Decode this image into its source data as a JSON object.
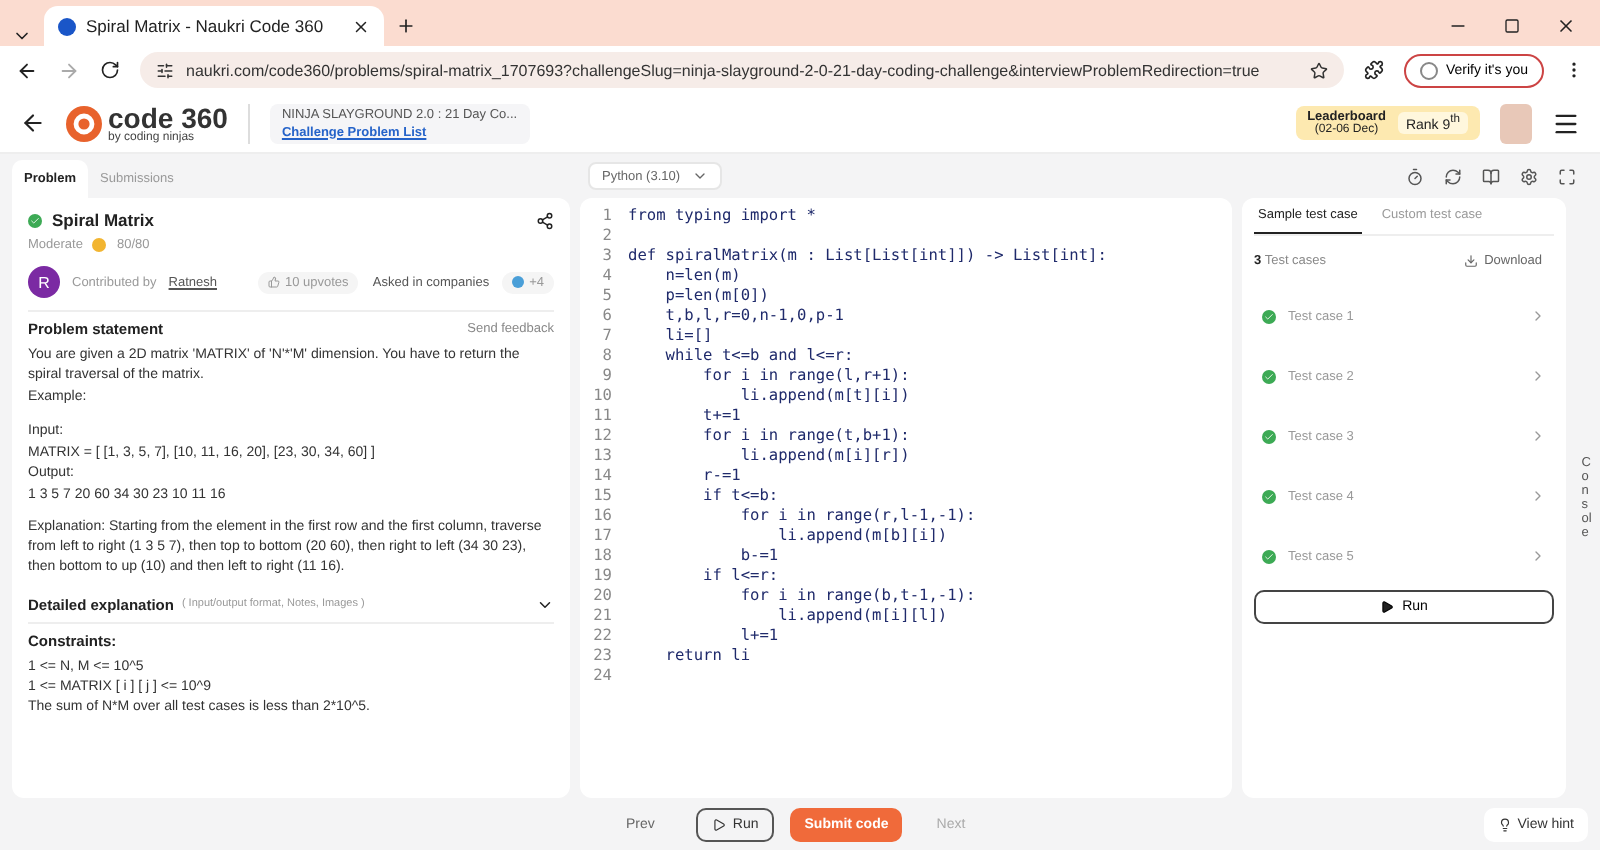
{
  "browser": {
    "tab_title": "Spiral Matrix - Naukri Code 360",
    "url": "naukri.com/code360/problems/spiral-matrix_1707693?challengeSlug=ninja-slayground-2-0-21-day-coding-challenge&interviewProblemRedirection=true",
    "verify": "Verify it's you"
  },
  "header": {
    "logo_main": "code 360",
    "logo_sub": "by coding ninjas",
    "challenge_title": "NINJA SLAYGROUND 2.0 : 21 Day Co...",
    "challenge_link": "Challenge Problem List",
    "leaderboard": "Leaderboard",
    "leaderboard_dates": "(02-06 Dec)",
    "rank": "Rank 9",
    "rank_sup": "th"
  },
  "problem_tabs": [
    {
      "label": "Problem",
      "selected": true
    },
    {
      "label": "Submissions",
      "selected": false
    }
  ],
  "problem": {
    "title": "Spiral Matrix",
    "solved": true,
    "difficulty": "Moderate",
    "score": "80/80",
    "avatar_letter": "R",
    "contributed_by": "Contributed by",
    "author": "Ratnesh",
    "upvotes": "10 upvotes",
    "asked_in": "Asked in companies",
    "companies_count": "+4",
    "statement_heading": "Problem statement",
    "feedback": "Send feedback",
    "paragraphs": [
      "You are given a 2D matrix 'MATRIX' of 'N'*'M' dimension. You have to return the spiral traversal of the matrix.",
      "Example:"
    ],
    "example_lines": [
      "Input:",
      "MATRIX = [ [1, 3, 5, 7], [10, 11, 16, 20], [23, 30, 34, 60] ]",
      "Output:",
      "1 3 5 7 20 60 34 30 23 10 11 16"
    ],
    "explanation": "Explanation: Starting from the element in the first row and the first column, traverse from left to right (1 3 5 7), then top to bottom (20 60), then right to left (34 30 23), then bottom to up (10) and then left to right (11 16).",
    "detailed_heading": "Detailed explanation",
    "detailed_hint": "( Input/output format, Notes, Images )",
    "detailed_expanded": false,
    "constraints_heading": "Constraints:",
    "constraints": [
      "1 <= N, M <= 10^5",
      "1 <= MATRIX [ i ] [ j ] <= 10^9",
      "The sum of N*M over all test cases is less than 2*10^5."
    ]
  },
  "editor": {
    "language": "Python (3.10)",
    "lines": [
      {
        "number": "1",
        "text": "from typing import *"
      },
      {
        "number": "2"
      },
      {
        "number": "3",
        "text": "def spiralMatrix(m : List[List[int]]) -> List[int]:"
      },
      {
        "number": "4",
        "text": "    n=len(m)"
      },
      {
        "number": "5",
        "text": "    p=len(m[0])"
      },
      {
        "number": "6",
        "text": "    t,b,l,r=0,n-1,0,p-1"
      },
      {
        "number": "7",
        "text": "    li=[]"
      },
      {
        "number": "8",
        "text": "    while t<=b and l<=r:"
      },
      {
        "number": "9",
        "text": "        for i in range(l,r+1):"
      },
      {
        "number": "10",
        "text": "            li.append(m[t][i])"
      },
      {
        "number": "11",
        "text": "        t+=1"
      },
      {
        "number": "12",
        "text": "        for i in range(t,b+1):"
      },
      {
        "number": "13",
        "text": "            li.append(m[i][r])"
      },
      {
        "number": "14",
        "text": "        r-=1"
      },
      {
        "number": "15",
        "text": "        if t<=b:"
      },
      {
        "number": "16",
        "text": "            for i in range(r,l-1,-1):"
      },
      {
        "number": "17",
        "text": "                li.append(m[b][i])"
      },
      {
        "number": "18",
        "text": "            b-=1"
      },
      {
        "number": "19",
        "text": "        if l<=r:"
      },
      {
        "number": "20",
        "text": "            for i in range(b,t-1,-1):"
      },
      {
        "number": "21",
        "text": "                li.append(m[i][l])"
      },
      {
        "number": "22",
        "text": "            l+=1"
      },
      {
        "number": "23",
        "text": "    return li"
      },
      {
        "number": "24"
      }
    ]
  },
  "tests": {
    "tabs": [
      {
        "label": "Sample test case",
        "selected": true
      },
      {
        "label": "Custom test case",
        "selected": false
      }
    ],
    "count": "3",
    "count_label": "Test cases",
    "download": "Download",
    "cases": [
      {
        "label": "Test case 1",
        "passed": true
      },
      {
        "label": "Test case 2",
        "passed": true
      },
      {
        "label": "Test case 3",
        "passed": true
      },
      {
        "label": "Test case 4",
        "passed": true
      },
      {
        "label": "Test case 5",
        "passed": true
      }
    ],
    "run": "Run"
  },
  "console": "Console",
  "footer": {
    "prev": "Prev",
    "run": "Run",
    "submit": "Submit code",
    "next": "Next",
    "hint": "View hint"
  }
}
